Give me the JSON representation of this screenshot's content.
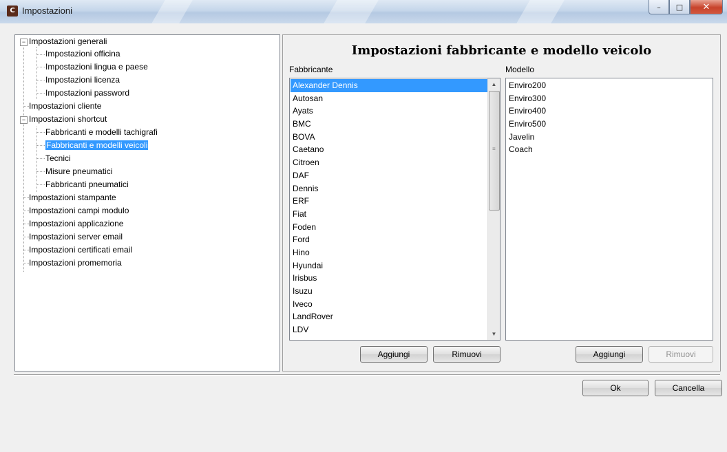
{
  "window": {
    "title": "Impostazioni",
    "icon": "app-icon"
  },
  "tree": {
    "items": [
      {
        "label": "Impostazioni generali",
        "expanded": true
      },
      {
        "label": "Impostazioni officina"
      },
      {
        "label": "Impostazioni lingua e paese"
      },
      {
        "label": "Impostazioni licenza"
      },
      {
        "label": "Impostazioni password"
      },
      {
        "label": "Impostazioni cliente"
      },
      {
        "label": "Impostazioni shortcut",
        "expanded": true
      },
      {
        "label": "Fabbricanti e modelli tachigrafi"
      },
      {
        "label": "Fabbricanti e modelli veicoli",
        "selected": true
      },
      {
        "label": "Tecnici"
      },
      {
        "label": "Misure pneumatici"
      },
      {
        "label": "Fabbricanti pneumatici"
      },
      {
        "label": "Impostazioni stampante"
      },
      {
        "label": "Impostazioni campi modulo"
      },
      {
        "label": "Impostazioni applicazione"
      },
      {
        "label": "Impostazioni server email"
      },
      {
        "label": "Impostazioni certificati email"
      },
      {
        "label": "Impostazioni promemoria"
      }
    ]
  },
  "panel": {
    "title": "Impostazioni fabbricante e modello veicolo",
    "manufacturers": {
      "label": "Fabbricante",
      "items": [
        "Alexander Dennis",
        "Autosan",
        "Ayats",
        "BMC",
        "BOVA",
        "Caetano",
        "Citroen",
        "DAF",
        "Dennis",
        "ERF",
        "Fiat",
        "Foden",
        "Ford",
        "Hino",
        "Hyundai",
        "Irisbus",
        "Isuzu",
        "Iveco",
        "LandRover",
        "LDV"
      ],
      "selected": "Alexander Dennis",
      "add_label": "Aggiungi",
      "remove_label": "Rimuovi"
    },
    "models": {
      "label": "Modello",
      "items": [
        "Enviro200",
        "Enviro300",
        "Enviro400",
        "Enviro500",
        "Javelin",
        "Coach"
      ],
      "add_label": "Aggiungi",
      "remove_label": "Rimuovi"
    }
  },
  "footer": {
    "ok_label": "Ok",
    "cancel_label": "Cancella"
  },
  "colors": {
    "selection": "#3399ff",
    "titlebar": "#c5d6ea",
    "close": "#c7432b"
  }
}
